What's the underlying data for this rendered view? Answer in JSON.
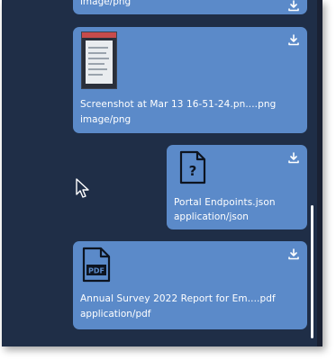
{
  "colors": {
    "panel_background": "#1f2e47",
    "card_background": "#5b8ac9",
    "card_text": "#ffffff"
  },
  "attachments": [
    {
      "name": "",
      "mime": "image/png",
      "icon": "image-thumbnail"
    },
    {
      "name": "Screenshot at Mar 13 16-51-24.pn....png",
      "mime": "image/png",
      "icon": "image-thumbnail"
    },
    {
      "name": "Portal Endpoints.json",
      "mime": "application/json",
      "icon": "unknown-file-icon"
    },
    {
      "name": "Annual Survey 2022 Report for Em....pdf",
      "mime": "application/pdf",
      "icon": "pdf-file-icon",
      "icon_label": "PDF"
    }
  ]
}
